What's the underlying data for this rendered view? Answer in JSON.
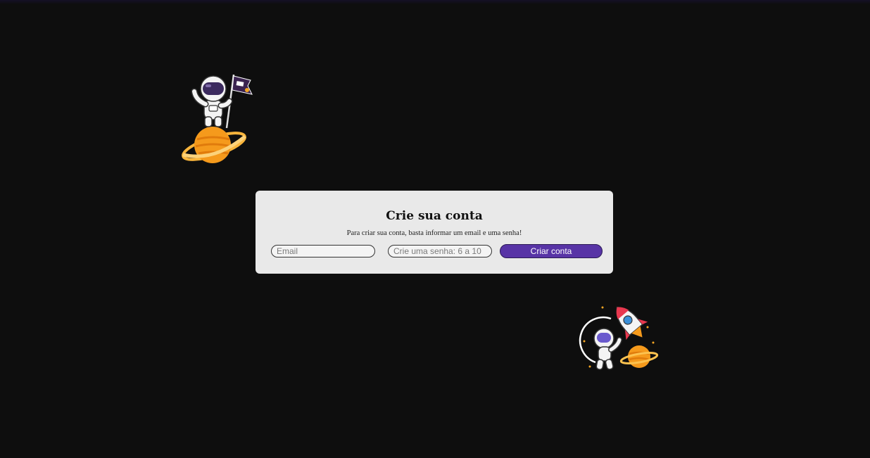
{
  "signup": {
    "title": "Crie sua conta",
    "subtitle": "Para criar sua conta, basta informar um email e uma senha!",
    "email_placeholder": "Email",
    "email_value": "",
    "password_placeholder": "Crie uma senha: 6 a 10",
    "password_value": "",
    "submit_label": "Criar conta"
  },
  "colors": {
    "background": "#0e0e0e",
    "card": "#e9e9e9",
    "button": "#5834a6",
    "planet": "#f59a1c",
    "astronaut_visor": "#3b2a5e"
  },
  "illustrations": {
    "top_left": "astronaut-on-planet-with-flag",
    "bottom_right": "astronaut-with-rocket-and-planet"
  }
}
